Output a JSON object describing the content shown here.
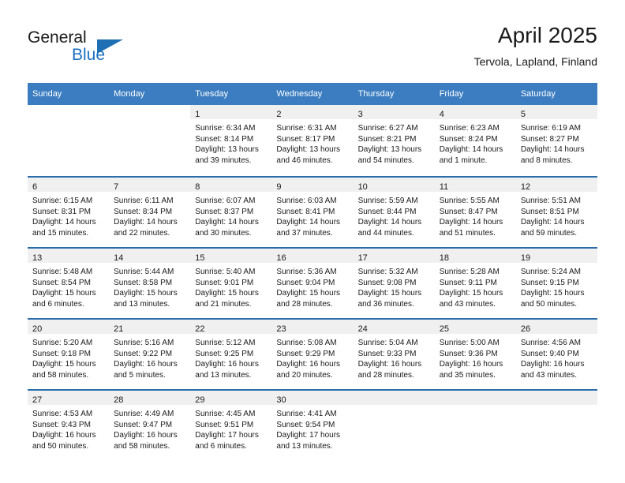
{
  "brand": {
    "name_top": "General",
    "name_bottom": "Blue",
    "accent_color": "#1f6fb5"
  },
  "header": {
    "title": "April 2025",
    "location": "Tervola, Lapland, Finland"
  },
  "theme": {
    "header_blue": "#3b7dc0",
    "rule_blue": "#2b6cab",
    "daynum_band": "#f0f0f0"
  },
  "weekday_headers": [
    "Sunday",
    "Monday",
    "Tuesday",
    "Wednesday",
    "Thursday",
    "Friday",
    "Saturday"
  ],
  "weeks": [
    [
      {
        "day": "",
        "sunrise": "",
        "sunset": "",
        "daylight1": "",
        "daylight2": ""
      },
      {
        "day": "",
        "sunrise": "",
        "sunset": "",
        "daylight1": "",
        "daylight2": ""
      },
      {
        "day": "1",
        "sunrise": "Sunrise: 6:34 AM",
        "sunset": "Sunset: 8:14 PM",
        "daylight1": "Daylight: 13 hours",
        "daylight2": "and 39 minutes."
      },
      {
        "day": "2",
        "sunrise": "Sunrise: 6:31 AM",
        "sunset": "Sunset: 8:17 PM",
        "daylight1": "Daylight: 13 hours",
        "daylight2": "and 46 minutes."
      },
      {
        "day": "3",
        "sunrise": "Sunrise: 6:27 AM",
        "sunset": "Sunset: 8:21 PM",
        "daylight1": "Daylight: 13 hours",
        "daylight2": "and 54 minutes."
      },
      {
        "day": "4",
        "sunrise": "Sunrise: 6:23 AM",
        "sunset": "Sunset: 8:24 PM",
        "daylight1": "Daylight: 14 hours",
        "daylight2": "and 1 minute."
      },
      {
        "day": "5",
        "sunrise": "Sunrise: 6:19 AM",
        "sunset": "Sunset: 8:27 PM",
        "daylight1": "Daylight: 14 hours",
        "daylight2": "and 8 minutes."
      }
    ],
    [
      {
        "day": "6",
        "sunrise": "Sunrise: 6:15 AM",
        "sunset": "Sunset: 8:31 PM",
        "daylight1": "Daylight: 14 hours",
        "daylight2": "and 15 minutes."
      },
      {
        "day": "7",
        "sunrise": "Sunrise: 6:11 AM",
        "sunset": "Sunset: 8:34 PM",
        "daylight1": "Daylight: 14 hours",
        "daylight2": "and 22 minutes."
      },
      {
        "day": "8",
        "sunrise": "Sunrise: 6:07 AM",
        "sunset": "Sunset: 8:37 PM",
        "daylight1": "Daylight: 14 hours",
        "daylight2": "and 30 minutes."
      },
      {
        "day": "9",
        "sunrise": "Sunrise: 6:03 AM",
        "sunset": "Sunset: 8:41 PM",
        "daylight1": "Daylight: 14 hours",
        "daylight2": "and 37 minutes."
      },
      {
        "day": "10",
        "sunrise": "Sunrise: 5:59 AM",
        "sunset": "Sunset: 8:44 PM",
        "daylight1": "Daylight: 14 hours",
        "daylight2": "and 44 minutes."
      },
      {
        "day": "11",
        "sunrise": "Sunrise: 5:55 AM",
        "sunset": "Sunset: 8:47 PM",
        "daylight1": "Daylight: 14 hours",
        "daylight2": "and 51 minutes."
      },
      {
        "day": "12",
        "sunrise": "Sunrise: 5:51 AM",
        "sunset": "Sunset: 8:51 PM",
        "daylight1": "Daylight: 14 hours",
        "daylight2": "and 59 minutes."
      }
    ],
    [
      {
        "day": "13",
        "sunrise": "Sunrise: 5:48 AM",
        "sunset": "Sunset: 8:54 PM",
        "daylight1": "Daylight: 15 hours",
        "daylight2": "and 6 minutes."
      },
      {
        "day": "14",
        "sunrise": "Sunrise: 5:44 AM",
        "sunset": "Sunset: 8:58 PM",
        "daylight1": "Daylight: 15 hours",
        "daylight2": "and 13 minutes."
      },
      {
        "day": "15",
        "sunrise": "Sunrise: 5:40 AM",
        "sunset": "Sunset: 9:01 PM",
        "daylight1": "Daylight: 15 hours",
        "daylight2": "and 21 minutes."
      },
      {
        "day": "16",
        "sunrise": "Sunrise: 5:36 AM",
        "sunset": "Sunset: 9:04 PM",
        "daylight1": "Daylight: 15 hours",
        "daylight2": "and 28 minutes."
      },
      {
        "day": "17",
        "sunrise": "Sunrise: 5:32 AM",
        "sunset": "Sunset: 9:08 PM",
        "daylight1": "Daylight: 15 hours",
        "daylight2": "and 36 minutes."
      },
      {
        "day": "18",
        "sunrise": "Sunrise: 5:28 AM",
        "sunset": "Sunset: 9:11 PM",
        "daylight1": "Daylight: 15 hours",
        "daylight2": "and 43 minutes."
      },
      {
        "day": "19",
        "sunrise": "Sunrise: 5:24 AM",
        "sunset": "Sunset: 9:15 PM",
        "daylight1": "Daylight: 15 hours",
        "daylight2": "and 50 minutes."
      }
    ],
    [
      {
        "day": "20",
        "sunrise": "Sunrise: 5:20 AM",
        "sunset": "Sunset: 9:18 PM",
        "daylight1": "Daylight: 15 hours",
        "daylight2": "and 58 minutes."
      },
      {
        "day": "21",
        "sunrise": "Sunrise: 5:16 AM",
        "sunset": "Sunset: 9:22 PM",
        "daylight1": "Daylight: 16 hours",
        "daylight2": "and 5 minutes."
      },
      {
        "day": "22",
        "sunrise": "Sunrise: 5:12 AM",
        "sunset": "Sunset: 9:25 PM",
        "daylight1": "Daylight: 16 hours",
        "daylight2": "and 13 minutes."
      },
      {
        "day": "23",
        "sunrise": "Sunrise: 5:08 AM",
        "sunset": "Sunset: 9:29 PM",
        "daylight1": "Daylight: 16 hours",
        "daylight2": "and 20 minutes."
      },
      {
        "day": "24",
        "sunrise": "Sunrise: 5:04 AM",
        "sunset": "Sunset: 9:33 PM",
        "daylight1": "Daylight: 16 hours",
        "daylight2": "and 28 minutes."
      },
      {
        "day": "25",
        "sunrise": "Sunrise: 5:00 AM",
        "sunset": "Sunset: 9:36 PM",
        "daylight1": "Daylight: 16 hours",
        "daylight2": "and 35 minutes."
      },
      {
        "day": "26",
        "sunrise": "Sunrise: 4:56 AM",
        "sunset": "Sunset: 9:40 PM",
        "daylight1": "Daylight: 16 hours",
        "daylight2": "and 43 minutes."
      }
    ],
    [
      {
        "day": "27",
        "sunrise": "Sunrise: 4:53 AM",
        "sunset": "Sunset: 9:43 PM",
        "daylight1": "Daylight: 16 hours",
        "daylight2": "and 50 minutes."
      },
      {
        "day": "28",
        "sunrise": "Sunrise: 4:49 AM",
        "sunset": "Sunset: 9:47 PM",
        "daylight1": "Daylight: 16 hours",
        "daylight2": "and 58 minutes."
      },
      {
        "day": "29",
        "sunrise": "Sunrise: 4:45 AM",
        "sunset": "Sunset: 9:51 PM",
        "daylight1": "Daylight: 17 hours",
        "daylight2": "and 6 minutes."
      },
      {
        "day": "30",
        "sunrise": "Sunrise: 4:41 AM",
        "sunset": "Sunset: 9:54 PM",
        "daylight1": "Daylight: 17 hours",
        "daylight2": "and 13 minutes."
      },
      {
        "day": "",
        "sunrise": "",
        "sunset": "",
        "daylight1": "",
        "daylight2": ""
      },
      {
        "day": "",
        "sunrise": "",
        "sunset": "",
        "daylight1": "",
        "daylight2": ""
      },
      {
        "day": "",
        "sunrise": "",
        "sunset": "",
        "daylight1": "",
        "daylight2": ""
      }
    ]
  ]
}
